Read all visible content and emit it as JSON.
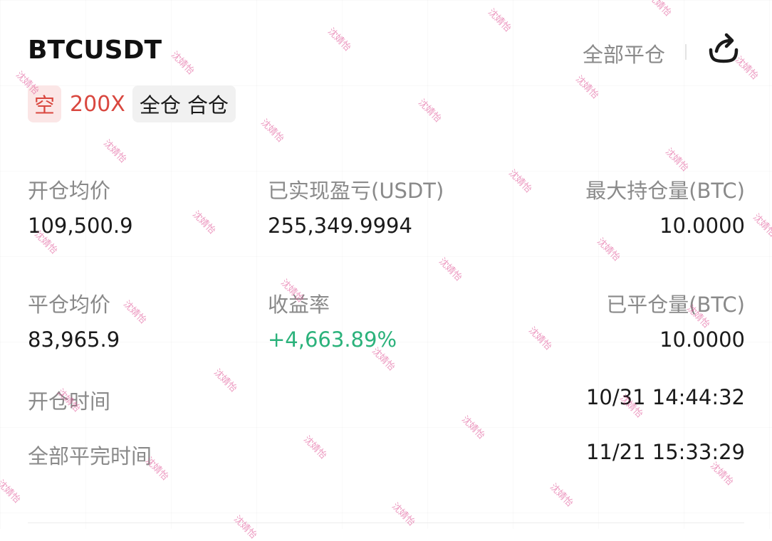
{
  "header": {
    "symbol": "BTCUSDT",
    "close_all_label": "全部平仓",
    "share_icon": "share-icon"
  },
  "tags": {
    "direction": "空",
    "leverage": "200X",
    "margin_mode": "全仓 合仓"
  },
  "stats": {
    "open_avg_price_label": "开仓均价",
    "open_avg_price_value": "109,500.9",
    "realized_pnl_label": "已实现盈亏(USDT)",
    "realized_pnl_value": "255,349.9994",
    "max_position_label": "最大持仓量(BTC)",
    "max_position_value": "10.0000",
    "close_avg_price_label": "平仓均价",
    "close_avg_price_value": "83,965.9",
    "return_rate_label": "收益率",
    "return_rate_value": "+4,663.89%",
    "closed_qty_label": "已平仓量(BTC)",
    "closed_qty_value": "10.0000",
    "open_time_label": "开仓时间",
    "open_time_value": "10/31 14:44:32",
    "full_close_time_label": "全部平完时间",
    "full_close_time_value": "11/21 15:33:29"
  },
  "colors": {
    "short_red": "#d9473f",
    "profit_green": "#2bb27b",
    "label_gray": "#8a8a8a"
  },
  "watermark_text": "沈婧怡"
}
